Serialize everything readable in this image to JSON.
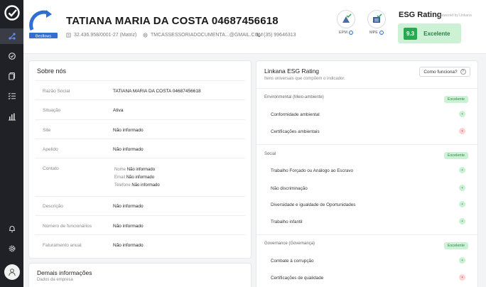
{
  "company": {
    "name": "TATIANA MARIA DA COSTA 04687456618",
    "cnpj": "32.436.958/0001-27 (Matriz)",
    "email": "TMCASSESSORIADOCUMENTA...@GMAIL.COM",
    "phone": "(35) 99646313",
    "logo_text": "Besflows"
  },
  "badges": [
    {
      "label": "EPM"
    },
    {
      "label": "MPE"
    }
  ],
  "esg": {
    "title": "ESG Rating",
    "powered": "powered by Linkana",
    "score": "9.3",
    "label": "Excelente"
  },
  "about": {
    "title": "Sobre nós",
    "rows": [
      {
        "label": "Razão Social",
        "value": "TATIANA MARIA DA COSTA 04687456618"
      },
      {
        "label": "Situação",
        "value": "Ativa"
      },
      {
        "label": "Site",
        "value": "Não informado"
      },
      {
        "label": "Apelido",
        "value": "Não informado"
      },
      {
        "label": "Contato",
        "value": ""
      },
      {
        "label": "Descrição",
        "value": "Não informado"
      },
      {
        "label": "Número de funcionários",
        "value": "Não informado"
      },
      {
        "label": "Faturamento anual",
        "value": "Não informado"
      }
    ],
    "contact": [
      {
        "key": "Nome",
        "value": "Não informado"
      },
      {
        "key": "Email",
        "value": "Não informado"
      },
      {
        "key": "Telefone",
        "value": "Não informado"
      }
    ]
  },
  "more": {
    "title": "Demais informações",
    "subtitle": "Dados da empresa"
  },
  "linkana": {
    "title": "Linkana ESG Rating",
    "subtitle": "Itens universais que compõem o indicador.",
    "help": "Como funciona?",
    "sections": [
      {
        "name": "Environmental (Meio-ambiente)",
        "rating": "Excelente",
        "items": [
          {
            "label": "Conformidade ambiental",
            "ok": true
          },
          {
            "label": "Certificações ambientais",
            "ok": false
          }
        ]
      },
      {
        "name": "Social",
        "rating": "Excelente",
        "items": [
          {
            "label": "Trabalho Forçado ou Análogo ao Escravo",
            "ok": true
          },
          {
            "label": "Não discriminação",
            "ok": true
          },
          {
            "label": "Diversidade e igualdade de Oportunidades",
            "ok": true
          },
          {
            "label": "Trabalho infantil",
            "ok": true
          }
        ]
      },
      {
        "name": "Governance (Governança)",
        "rating": "Excelente",
        "items": [
          {
            "label": "Combate à corrupção",
            "ok": true
          },
          {
            "label": "Certificações de qualidade",
            "ok": false
          }
        ]
      }
    ]
  }
}
